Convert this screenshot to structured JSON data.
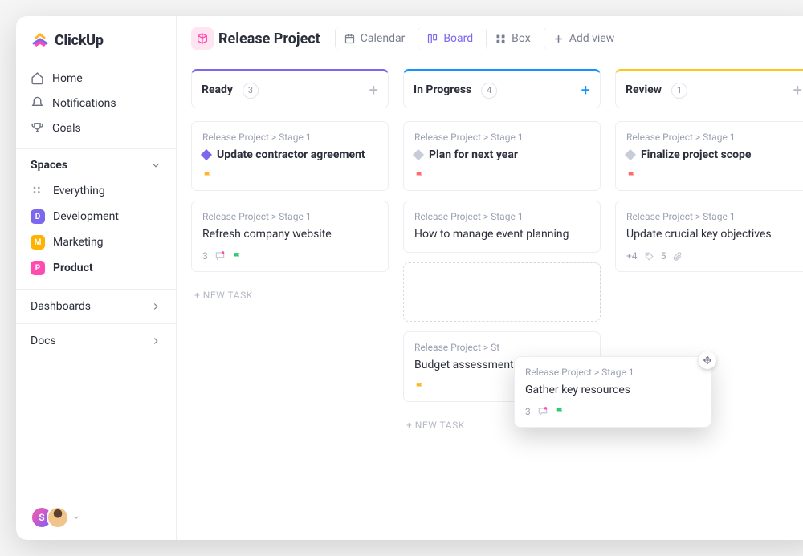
{
  "brand": {
    "name": "ClickUp"
  },
  "nav": {
    "home": "Home",
    "notifications": "Notifications",
    "goals": "Goals"
  },
  "spaces": {
    "header": "Spaces",
    "everything": "Everything",
    "items": [
      {
        "letter": "D",
        "label": "Development",
        "color": "#7b68ee"
      },
      {
        "letter": "M",
        "label": "Marketing",
        "color": "#ffb300"
      },
      {
        "letter": "P",
        "label": "Product",
        "color": "#ff4bb0",
        "selected": true
      }
    ]
  },
  "sections": {
    "dashboards": "Dashboards",
    "docs": "Docs"
  },
  "workspace": {
    "avatar_letter": "S"
  },
  "header": {
    "project_title": "Release Project",
    "views": {
      "calendar": "Calendar",
      "board": "Board",
      "box": "Box",
      "add": "Add view"
    }
  },
  "board": {
    "new_task_label": "+ NEW TASK",
    "columns": [
      {
        "title": "Ready",
        "count": "3",
        "cards": [
          {
            "crumb": "Release Project > Stage 1",
            "title": "Update contractor agreement",
            "bold": true,
            "diamond": "purple",
            "flag": "orange"
          },
          {
            "crumb": "Release Project > Stage 1",
            "title": "Refresh company website",
            "bold": false,
            "comments": "3",
            "flag": "green"
          }
        ]
      },
      {
        "title": "In Progress",
        "count": "4",
        "cards": [
          {
            "crumb": "Release Project > Stage 1",
            "title": "Plan for next year",
            "bold": true,
            "diamond": "grey",
            "flag": "red"
          },
          {
            "crumb": "Release Project > Stage 1",
            "title": "How to manage event planning",
            "bold": false
          },
          {
            "placeholder": true
          },
          {
            "crumb": "Release Project > St",
            "title": "Budget assessment",
            "bold": false,
            "flag": "orange"
          }
        ]
      },
      {
        "title": "Review",
        "count": "1",
        "cards": [
          {
            "crumb": "Release Project > Stage 1",
            "title": "Finalize project scope",
            "bold": true,
            "diamond": "grey",
            "flag": "red"
          },
          {
            "crumb": "Release Project > Stage 1",
            "title": "Update crucial key objectives",
            "bold": false,
            "tags": "+4",
            "clips": "5"
          }
        ]
      }
    ],
    "dragging": {
      "crumb": "Release Project > Stage 1",
      "title": "Gather key resources",
      "comments": "3",
      "flag": "green"
    }
  }
}
